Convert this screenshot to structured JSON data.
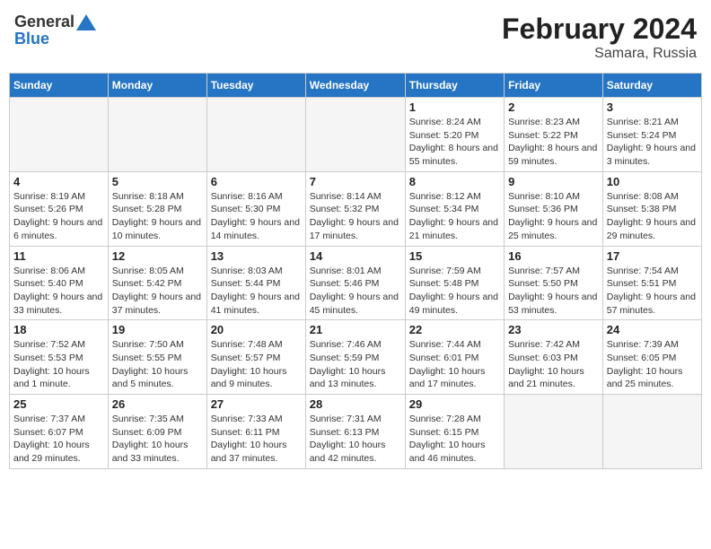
{
  "header": {
    "logo_general": "General",
    "logo_blue": "Blue",
    "month_year": "February 2024",
    "location": "Samara, Russia"
  },
  "weekdays": [
    "Sunday",
    "Monday",
    "Tuesday",
    "Wednesday",
    "Thursday",
    "Friday",
    "Saturday"
  ],
  "weeks": [
    [
      {
        "day": "",
        "info": ""
      },
      {
        "day": "",
        "info": ""
      },
      {
        "day": "",
        "info": ""
      },
      {
        "day": "",
        "info": ""
      },
      {
        "day": "1",
        "info": "Sunrise: 8:24 AM\nSunset: 5:20 PM\nDaylight: 8 hours and 55 minutes."
      },
      {
        "day": "2",
        "info": "Sunrise: 8:23 AM\nSunset: 5:22 PM\nDaylight: 8 hours and 59 minutes."
      },
      {
        "day": "3",
        "info": "Sunrise: 8:21 AM\nSunset: 5:24 PM\nDaylight: 9 hours and 3 minutes."
      }
    ],
    [
      {
        "day": "4",
        "info": "Sunrise: 8:19 AM\nSunset: 5:26 PM\nDaylight: 9 hours and 6 minutes."
      },
      {
        "day": "5",
        "info": "Sunrise: 8:18 AM\nSunset: 5:28 PM\nDaylight: 9 hours and 10 minutes."
      },
      {
        "day": "6",
        "info": "Sunrise: 8:16 AM\nSunset: 5:30 PM\nDaylight: 9 hours and 14 minutes."
      },
      {
        "day": "7",
        "info": "Sunrise: 8:14 AM\nSunset: 5:32 PM\nDaylight: 9 hours and 17 minutes."
      },
      {
        "day": "8",
        "info": "Sunrise: 8:12 AM\nSunset: 5:34 PM\nDaylight: 9 hours and 21 minutes."
      },
      {
        "day": "9",
        "info": "Sunrise: 8:10 AM\nSunset: 5:36 PM\nDaylight: 9 hours and 25 minutes."
      },
      {
        "day": "10",
        "info": "Sunrise: 8:08 AM\nSunset: 5:38 PM\nDaylight: 9 hours and 29 minutes."
      }
    ],
    [
      {
        "day": "11",
        "info": "Sunrise: 8:06 AM\nSunset: 5:40 PM\nDaylight: 9 hours and 33 minutes."
      },
      {
        "day": "12",
        "info": "Sunrise: 8:05 AM\nSunset: 5:42 PM\nDaylight: 9 hours and 37 minutes."
      },
      {
        "day": "13",
        "info": "Sunrise: 8:03 AM\nSunset: 5:44 PM\nDaylight: 9 hours and 41 minutes."
      },
      {
        "day": "14",
        "info": "Sunrise: 8:01 AM\nSunset: 5:46 PM\nDaylight: 9 hours and 45 minutes."
      },
      {
        "day": "15",
        "info": "Sunrise: 7:59 AM\nSunset: 5:48 PM\nDaylight: 9 hours and 49 minutes."
      },
      {
        "day": "16",
        "info": "Sunrise: 7:57 AM\nSunset: 5:50 PM\nDaylight: 9 hours and 53 minutes."
      },
      {
        "day": "17",
        "info": "Sunrise: 7:54 AM\nSunset: 5:51 PM\nDaylight: 9 hours and 57 minutes."
      }
    ],
    [
      {
        "day": "18",
        "info": "Sunrise: 7:52 AM\nSunset: 5:53 PM\nDaylight: 10 hours and 1 minute."
      },
      {
        "day": "19",
        "info": "Sunrise: 7:50 AM\nSunset: 5:55 PM\nDaylight: 10 hours and 5 minutes."
      },
      {
        "day": "20",
        "info": "Sunrise: 7:48 AM\nSunset: 5:57 PM\nDaylight: 10 hours and 9 minutes."
      },
      {
        "day": "21",
        "info": "Sunrise: 7:46 AM\nSunset: 5:59 PM\nDaylight: 10 hours and 13 minutes."
      },
      {
        "day": "22",
        "info": "Sunrise: 7:44 AM\nSunset: 6:01 PM\nDaylight: 10 hours and 17 minutes."
      },
      {
        "day": "23",
        "info": "Sunrise: 7:42 AM\nSunset: 6:03 PM\nDaylight: 10 hours and 21 minutes."
      },
      {
        "day": "24",
        "info": "Sunrise: 7:39 AM\nSunset: 6:05 PM\nDaylight: 10 hours and 25 minutes."
      }
    ],
    [
      {
        "day": "25",
        "info": "Sunrise: 7:37 AM\nSunset: 6:07 PM\nDaylight: 10 hours and 29 minutes."
      },
      {
        "day": "26",
        "info": "Sunrise: 7:35 AM\nSunset: 6:09 PM\nDaylight: 10 hours and 33 minutes."
      },
      {
        "day": "27",
        "info": "Sunrise: 7:33 AM\nSunset: 6:11 PM\nDaylight: 10 hours and 37 minutes."
      },
      {
        "day": "28",
        "info": "Sunrise: 7:31 AM\nSunset: 6:13 PM\nDaylight: 10 hours and 42 minutes."
      },
      {
        "day": "29",
        "info": "Sunrise: 7:28 AM\nSunset: 6:15 PM\nDaylight: 10 hours and 46 minutes."
      },
      {
        "day": "",
        "info": ""
      },
      {
        "day": "",
        "info": ""
      }
    ]
  ]
}
